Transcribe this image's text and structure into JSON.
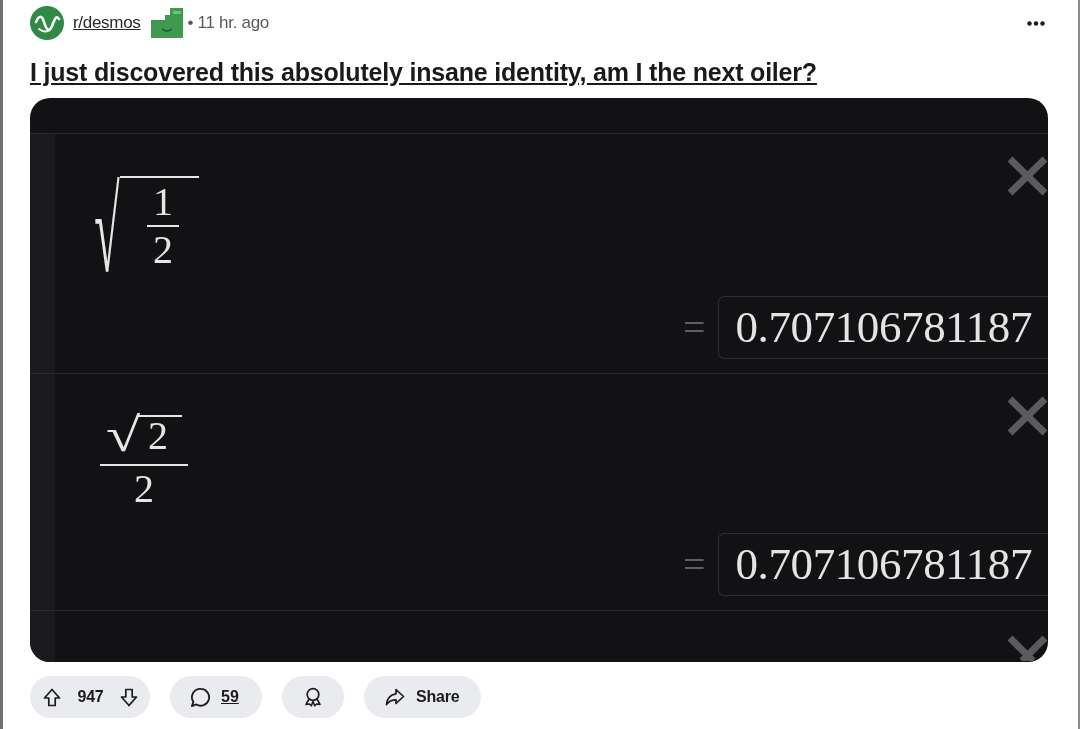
{
  "post": {
    "community": "r/desmos",
    "time": "• 11 hr. ago",
    "title": "I just discovered this absolutely insane identity, am I the next oiler?"
  },
  "calculator": {
    "expressions": [
      {
        "kind": "sqrt_fraction",
        "radical": "√",
        "numerator": "1",
        "denominator": "2",
        "equals": "=",
        "result": "0.707106781187"
      },
      {
        "kind": "fraction_sqrt",
        "radical": "√",
        "radicand": "2",
        "denominator": "2",
        "equals": "=",
        "result": "0.707106781187"
      },
      {
        "kind": "empty"
      }
    ]
  },
  "actions": [
    {
      "kind": "vote",
      "score": "947"
    },
    {
      "kind": "comments",
      "count": "59"
    },
    {
      "kind": "award"
    },
    {
      "kind": "share",
      "label": "Share"
    }
  ]
}
